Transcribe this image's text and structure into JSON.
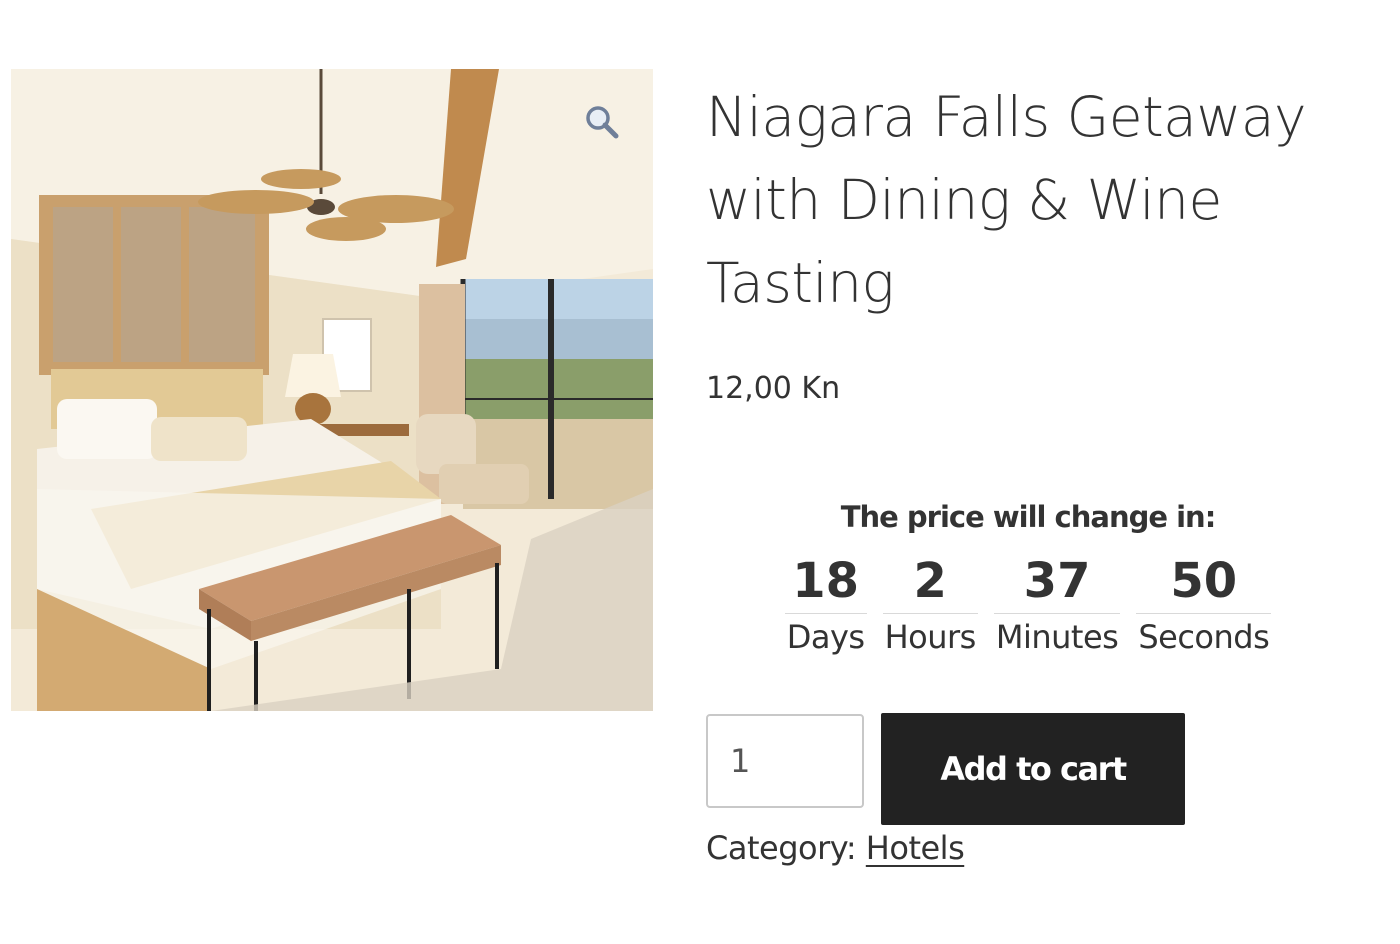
{
  "product": {
    "title": "Niagara Falls Getaway with Dining & Wine Tasting",
    "price": "12,00 Kn",
    "image_icon": "bedroom-photo",
    "zoom_icon": "magnifier-icon"
  },
  "countdown": {
    "heading": "The price will change in:",
    "units": [
      {
        "value": "18",
        "label": "Days"
      },
      {
        "value": "2",
        "label": "Hours"
      },
      {
        "value": "37",
        "label": "Minutes"
      },
      {
        "value": "50",
        "label": "Seconds"
      }
    ]
  },
  "cart": {
    "quantity": "1",
    "button_label": "Add to cart"
  },
  "meta": {
    "category_label": "Category: ",
    "category_link": "Hotels"
  },
  "colors": {
    "button_bg": "#222222",
    "text": "#333333"
  }
}
